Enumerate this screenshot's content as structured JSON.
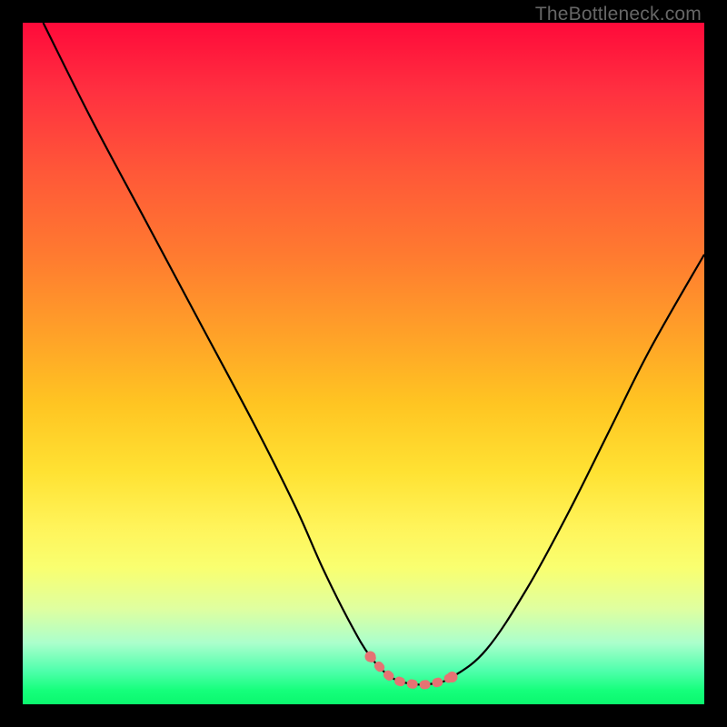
{
  "attribution": "TheBottleneck.com",
  "colors": {
    "background_frame": "#000000",
    "curve_main": "#000000",
    "curve_highlight": "#e57373",
    "gradient_top": "#ff0a3a",
    "gradient_bottom": "#0bf76e"
  },
  "chart_data": {
    "type": "line",
    "title": "",
    "xlabel": "",
    "ylabel": "",
    "xlim": [
      0,
      100
    ],
    "ylim": [
      0,
      100
    ],
    "grid": false,
    "legend_position": "none",
    "series": [
      {
        "name": "bottleneck-curve",
        "color": "#000000",
        "x": [
          3,
          10,
          18,
          26,
          34,
          40,
          44,
          48,
          51,
          54,
          57,
          60,
          63,
          68,
          74,
          80,
          86,
          92,
          100
        ],
        "y": [
          100,
          86,
          71,
          56,
          41,
          29,
          20,
          12,
          7,
          4,
          3,
          3,
          4,
          8,
          17,
          28,
          40,
          52,
          66
        ]
      },
      {
        "name": "optimal-range-highlight",
        "color": "#e57373",
        "x": [
          51,
          54,
          57,
          60,
          63
        ],
        "y": [
          7,
          4,
          3,
          3,
          4
        ]
      }
    ]
  }
}
